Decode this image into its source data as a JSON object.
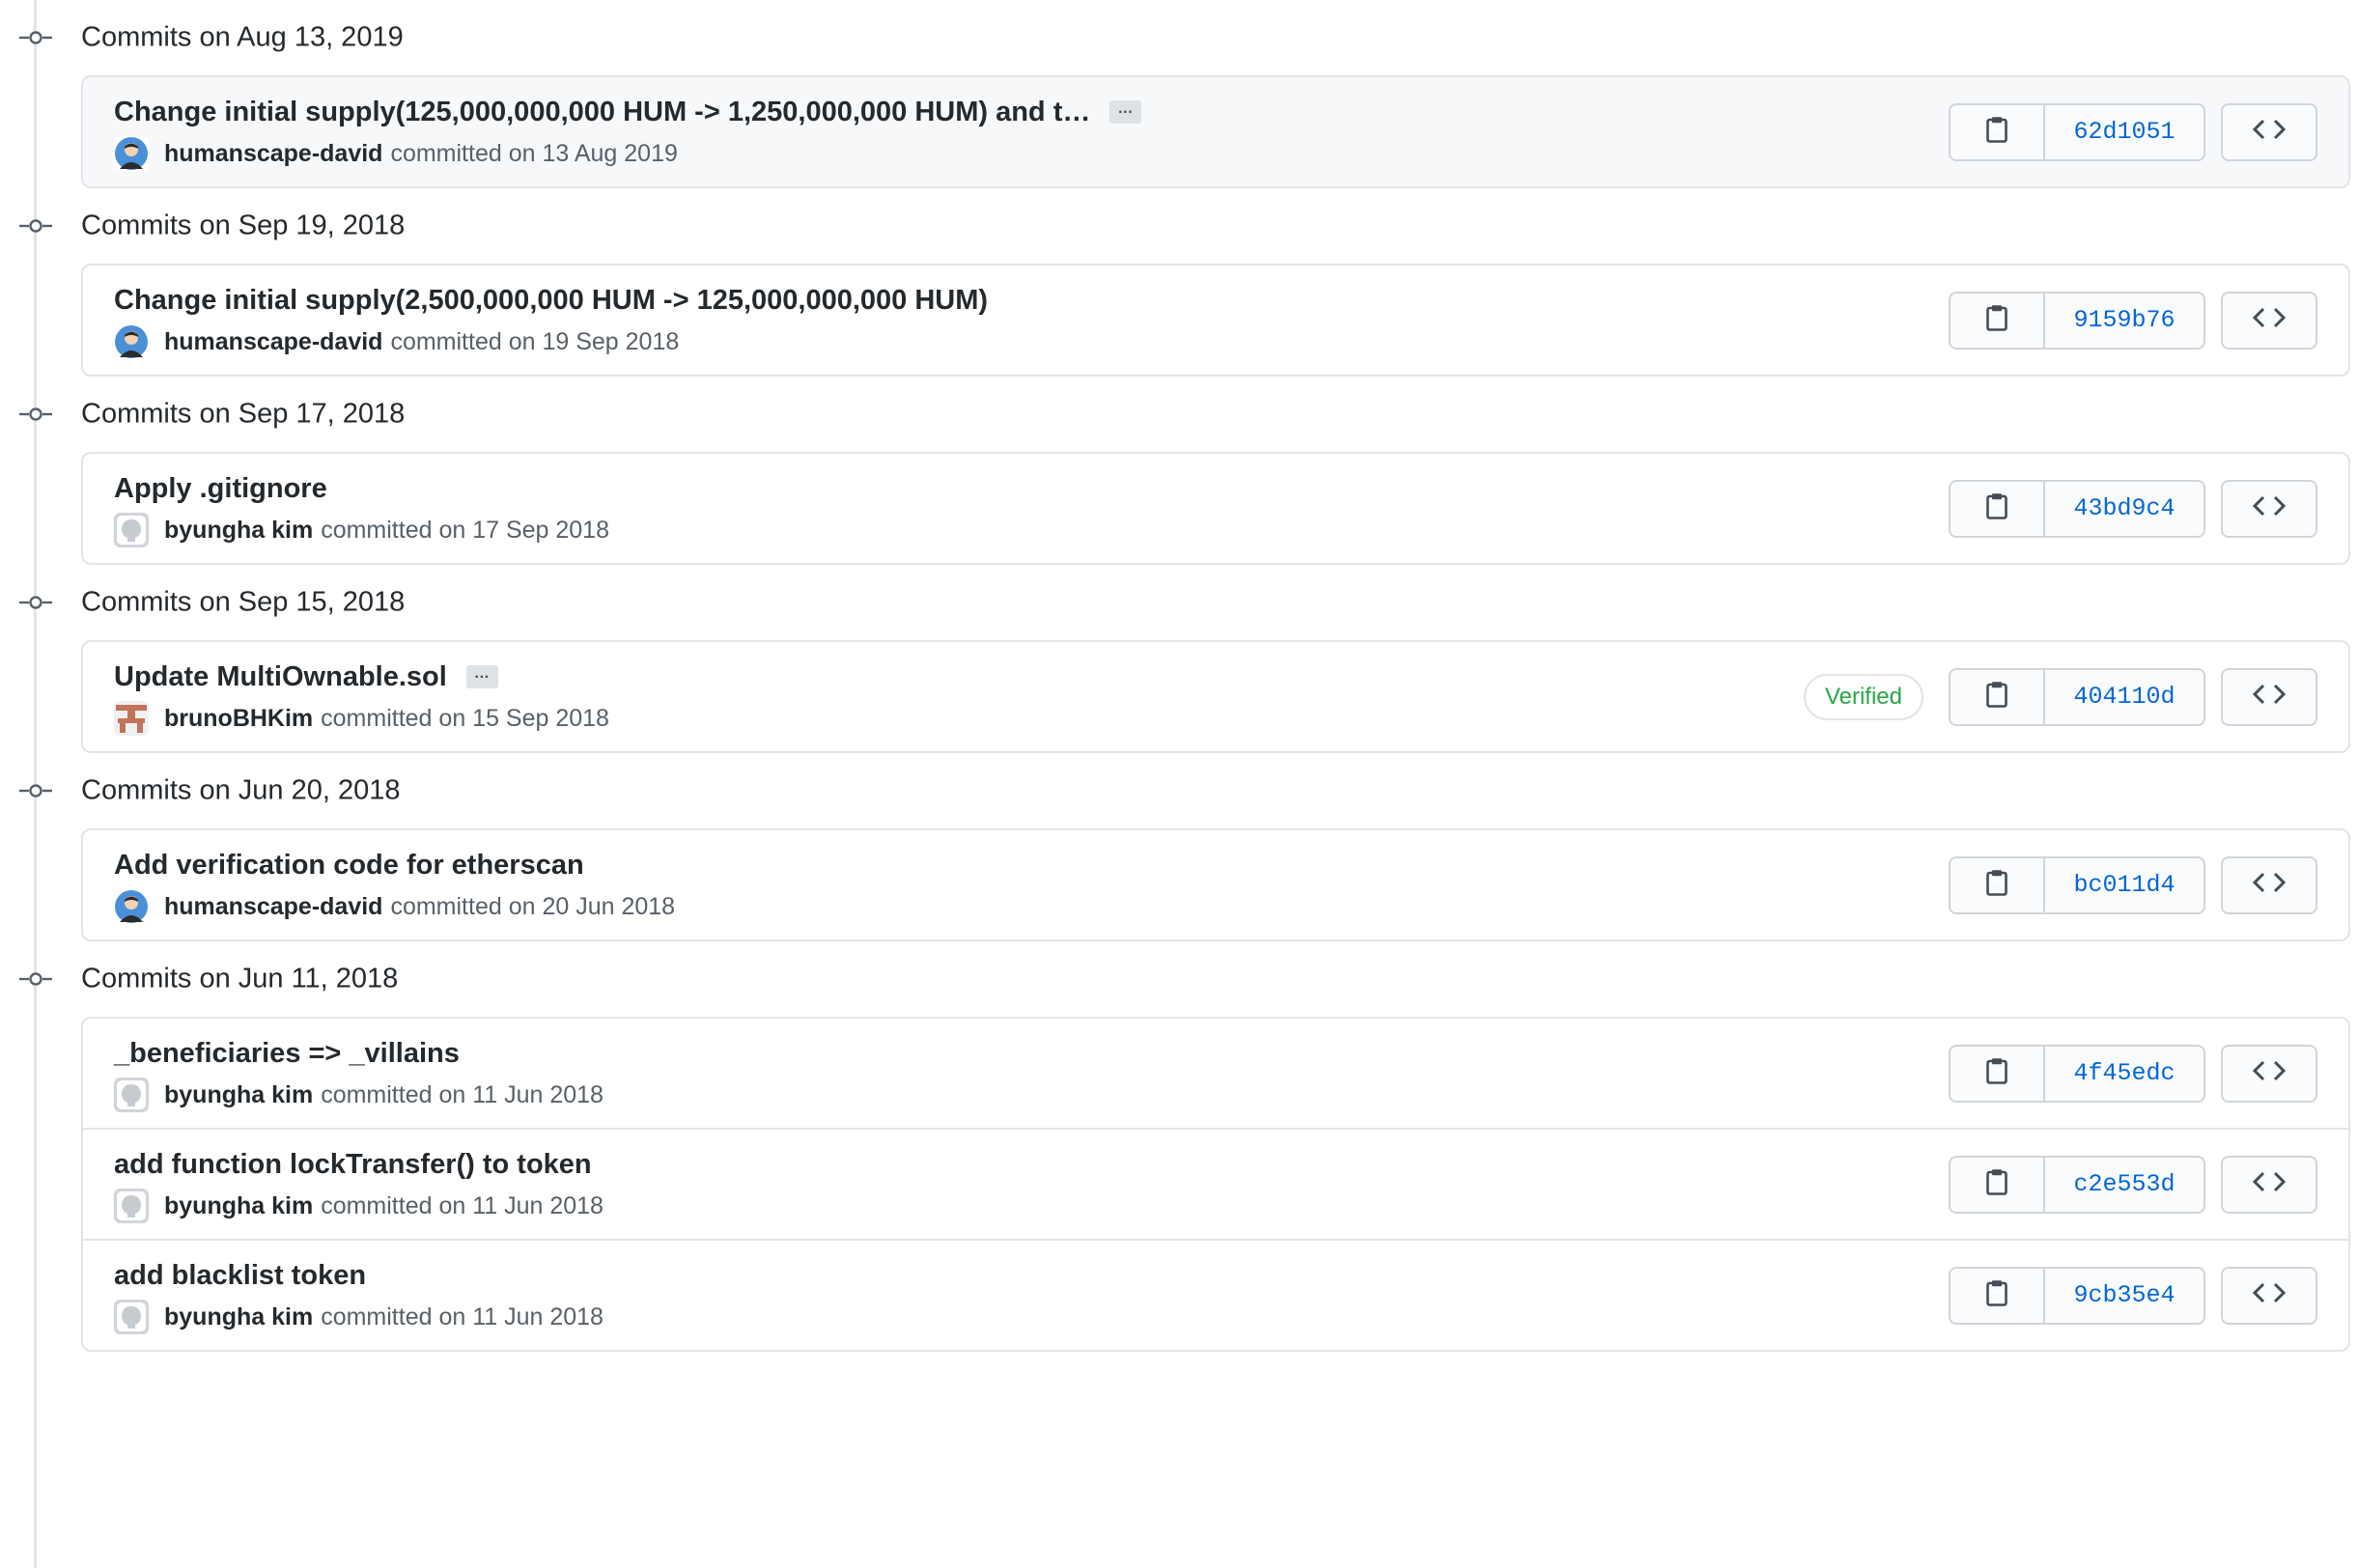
{
  "groups": [
    {
      "title": "Commits on Aug 13, 2019",
      "commits": [
        {
          "message": "Change initial supply(125,000,000,000 HUM -> 1,250,000,000 HUM) and t…",
          "has_more": true,
          "author": "humanscape-david",
          "committed": "committed on 13 Aug 2019",
          "avatar": "humanscape-avatar",
          "sha": "62d1051",
          "verified": null
        }
      ]
    },
    {
      "title": "Commits on Sep 19, 2018",
      "commits": [
        {
          "message": "Change initial supply(2,500,000,000 HUM -> 125,000,000,000 HUM)",
          "has_more": false,
          "author": "humanscape-david",
          "committed": "committed on 19 Sep 2018",
          "avatar": "humanscape-avatar",
          "sha": "9159b76",
          "verified": null
        }
      ]
    },
    {
      "title": "Commits on Sep 17, 2018",
      "commits": [
        {
          "message": "Apply .gitignore",
          "has_more": false,
          "author": "byungha kim",
          "committed": "committed on 17 Sep 2018",
          "avatar": "github-default-avatar",
          "sha": "43bd9c4",
          "verified": null
        }
      ]
    },
    {
      "title": "Commits on Sep 15, 2018",
      "commits": [
        {
          "message": "Update MultiOwnable.sol",
          "has_more": true,
          "author": "brunoBHKim",
          "committed": "committed on 15 Sep 2018",
          "avatar": "identicon-avatar",
          "sha": "404110d",
          "verified": "Verified"
        }
      ]
    },
    {
      "title": "Commits on Jun 20, 2018",
      "commits": [
        {
          "message": "Add verification code for etherscan",
          "has_more": false,
          "author": "humanscape-david",
          "committed": "committed on 20 Jun 2018",
          "avatar": "humanscape-avatar",
          "sha": "bc011d4",
          "verified": null
        }
      ]
    },
    {
      "title": "Commits on Jun 11, 2018",
      "commits": [
        {
          "message": "_beneficiaries => _villains",
          "has_more": false,
          "author": "byungha kim",
          "committed": "committed on 11 Jun 2018",
          "avatar": "github-default-avatar",
          "sha": "4f45edc",
          "verified": null
        },
        {
          "message": "add function lockTransfer() to token",
          "has_more": false,
          "author": "byungha kim",
          "committed": "committed on 11 Jun 2018",
          "avatar": "github-default-avatar",
          "sha": "c2e553d",
          "verified": null
        },
        {
          "message": "add blacklist token",
          "has_more": false,
          "author": "byungha kim",
          "committed": "committed on 11 Jun 2018",
          "avatar": "github-default-avatar",
          "sha": "9cb35e4",
          "verified": null
        }
      ]
    }
  ],
  "labels": {
    "ellipsis": "…"
  },
  "icons": {
    "commit": "git-commit-icon",
    "copy": "clipboard-icon",
    "browse": "code-icon",
    "ellipsis": "ellipsis-icon"
  },
  "colors": {
    "link": "#0366d6",
    "verified": "#28a745",
    "border": "#e1e4e8",
    "timeline": "#e1e4e8",
    "highlight_row": "#f6f8fa"
  }
}
